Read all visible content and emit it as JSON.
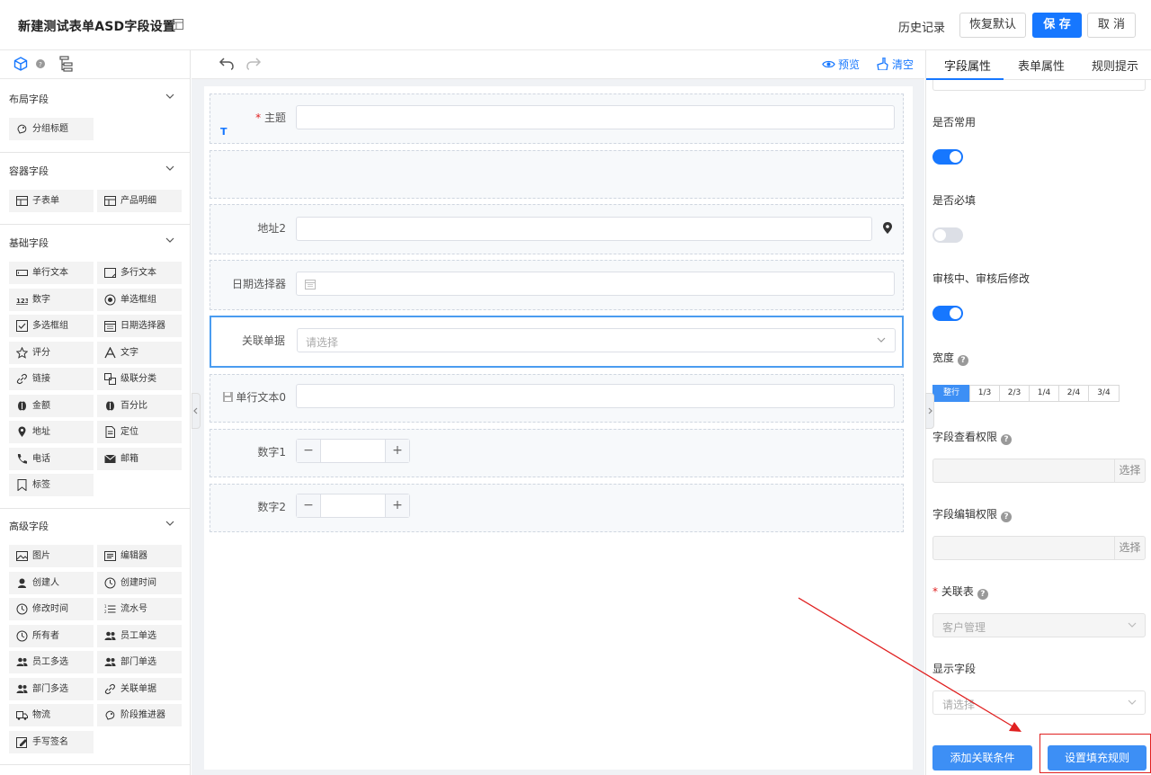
{
  "header": {
    "title": "新建测试表单ASD字段设置",
    "history_label": "历史记录",
    "restore_label": "恢复默认",
    "save_label": "保 存",
    "cancel_label": "取 消"
  },
  "left_panel": {
    "sections": [
      {
        "title": "布局字段",
        "items": [
          {
            "label": "分组标题",
            "icon": "group-title-icon"
          }
        ]
      },
      {
        "title": "容器字段",
        "items": [
          {
            "label": "子表单",
            "icon": "table-icon"
          },
          {
            "label": "产品明细",
            "icon": "table-icon"
          }
        ]
      },
      {
        "title": "基础字段",
        "items": [
          {
            "label": "单行文本",
            "icon": "single-line-text-icon"
          },
          {
            "label": "多行文本",
            "icon": "multi-line-text-icon"
          },
          {
            "label": "数字",
            "icon": "number-icon"
          },
          {
            "label": "单选框组",
            "icon": "radio-icon"
          },
          {
            "label": "多选框组",
            "icon": "checkbox-icon"
          },
          {
            "label": "日期选择器",
            "icon": "calendar-icon"
          },
          {
            "label": "评分",
            "icon": "star-icon"
          },
          {
            "label": "文字",
            "icon": "text-icon"
          },
          {
            "label": "链接",
            "icon": "link-icon"
          },
          {
            "label": "级联分类",
            "icon": "cascade-icon"
          },
          {
            "label": "金额",
            "icon": "money-icon"
          },
          {
            "label": "百分比",
            "icon": "percent-icon"
          },
          {
            "label": "地址",
            "icon": "location-pin-icon"
          },
          {
            "label": "定位",
            "icon": "document-icon"
          },
          {
            "label": "电话",
            "icon": "phone-icon"
          },
          {
            "label": "邮箱",
            "icon": "mail-icon"
          },
          {
            "label": "标签",
            "icon": "tag-icon"
          }
        ]
      },
      {
        "title": "高级字段",
        "items": [
          {
            "label": "图片",
            "icon": "image-icon"
          },
          {
            "label": "编辑器",
            "icon": "editor-icon"
          },
          {
            "label": "创建人",
            "icon": "user-icon"
          },
          {
            "label": "创建时间",
            "icon": "clock-icon"
          },
          {
            "label": "修改时间",
            "icon": "clock-icon"
          },
          {
            "label": "流水号",
            "icon": "ordered-list-icon"
          },
          {
            "label": "所有者",
            "icon": "clock-icon"
          },
          {
            "label": "员工单选",
            "icon": "users-icon"
          },
          {
            "label": "员工多选",
            "icon": "users-icon"
          },
          {
            "label": "部门单选",
            "icon": "users-icon"
          },
          {
            "label": "部门多选",
            "icon": "users-icon"
          },
          {
            "label": "关联单据",
            "icon": "link-icon"
          },
          {
            "label": "物流",
            "icon": "truck-icon"
          },
          {
            "label": "阶段推进器",
            "icon": "stage-icon"
          },
          {
            "label": "手写签名",
            "icon": "signature-icon"
          }
        ]
      }
    ]
  },
  "center": {
    "preview_label": "预览",
    "clear_label": "清空",
    "fields": [
      {
        "label": "主题",
        "required": true,
        "badge": "T"
      },
      {
        "label": ""
      },
      {
        "label": "地址2"
      },
      {
        "label": "日期选择器"
      },
      {
        "label": "关联单据",
        "placeholder": "请选择"
      },
      {
        "label": "单行文本0"
      },
      {
        "label": "数字1"
      },
      {
        "label": "数字2"
      }
    ]
  },
  "right_panel": {
    "tabs": [
      "字段属性",
      "表单属性",
      "规则提示"
    ],
    "active_tab": 0,
    "common_label": "是否常用",
    "common_on": true,
    "required_label": "是否必填",
    "required_on": false,
    "edit_label": "审核中、审核后修改",
    "edit_on": true,
    "width_label": "宽度",
    "width_options": [
      "整行",
      "1/3",
      "2/3",
      "1/4",
      "2/4",
      "3/4"
    ],
    "width_selected": 0,
    "view_perm_label": "字段查看权限",
    "edit_perm_label": "字段编辑权限",
    "select_label": "选择",
    "assoc_table_label": "关联表",
    "assoc_table_value": "客户管理",
    "display_field_label": "显示字段",
    "display_field_placeholder": "请选择",
    "add_condition_label": "添加关联条件",
    "fill_rule_label": "设置填充规则"
  },
  "colors": {
    "primary": "#1677ff",
    "accent_blue": "#3d8ff5",
    "annotation_red": "#e02020"
  }
}
